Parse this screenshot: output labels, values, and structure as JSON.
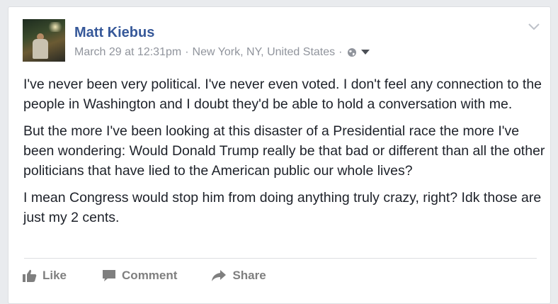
{
  "post": {
    "author": "Matt Kiebus",
    "date": "March 29 at 12:31pm",
    "separator": "·",
    "location": "New York, NY, United States",
    "privacy_icon": "globe-icon",
    "paragraphs": [
      "I've never been very political. I've never even voted. I don't feel any connection to the people in Washington and I doubt they'd be able to hold a conversation with me.",
      "But the more I've been looking at this disaster of a Presidential race the more I've been wondering: Would Donald Trump really be that bad or different than all the other politicians that have lied to the American public our whole lives?",
      "I mean Congress would stop him from doing anything truly crazy, right? Idk those are just my 2 cents."
    ]
  },
  "actions": {
    "like": "Like",
    "comment": "Comment",
    "share": "Share"
  },
  "colors": {
    "author": "#365899",
    "meta": "#90949c",
    "text": "#1d2129",
    "action": "#7f7f7f"
  }
}
